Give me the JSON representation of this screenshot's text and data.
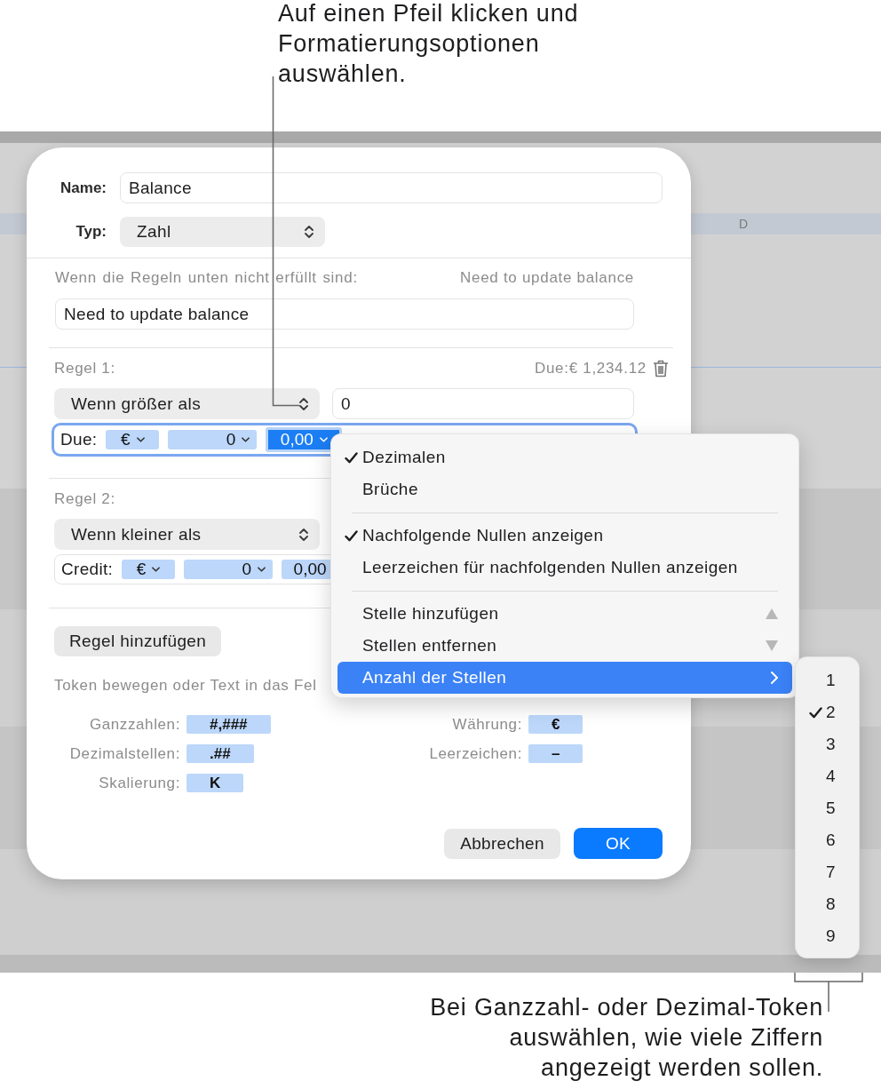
{
  "callout_top": {
    "lines": [
      "Auf einen Pfeil klicken und",
      "Formatierungsoptionen",
      "auswählen."
    ]
  },
  "spreadsheet": {
    "column_header": "D"
  },
  "dialog": {
    "name_label": "Name:",
    "name_value": "Balance",
    "type_label": "Typ:",
    "type_value": "Zahl",
    "fallback_label": "Wenn die Regeln unten nicht erfüllt sind:",
    "fallback_preview": "Need to update balance",
    "fallback_value": "Need to update balance",
    "rules": [
      {
        "label": "Regel 1:",
        "preview": "Due:€ 1,234.12",
        "trash": true,
        "condition": "Wenn größer als",
        "value": "0",
        "format": {
          "focused": true,
          "prefix": "Due:",
          "tokens": [
            {
              "kind": "currency",
              "text": "€",
              "selected": false
            },
            {
              "kind": "integer",
              "text": "0",
              "selected": false
            },
            {
              "kind": "decimal",
              "text": "0,00",
              "selected": true
            }
          ]
        }
      },
      {
        "label": "Regel 2:",
        "condition": "Wenn kleiner als",
        "format": {
          "focused": false,
          "prefix": "Credit:",
          "tokens": [
            {
              "kind": "currency",
              "text": "€",
              "selected": false
            },
            {
              "kind": "integer",
              "text": "0",
              "selected": false
            },
            {
              "kind": "decimal",
              "text": "0,00",
              "selected": false
            }
          ]
        }
      }
    ],
    "add_rule_button": "Regel hinzufügen",
    "token_hint": "Token bewegen oder Text in das Fel",
    "legend_left": [
      {
        "label": "Ganzzahlen:",
        "token": "#,###"
      },
      {
        "label": "Dezimalstellen:",
        "token": ".##"
      },
      {
        "label": "Skalierung:",
        "token": "K"
      }
    ],
    "legend_right": [
      {
        "label": "Währung:",
        "token": "€"
      },
      {
        "label": "Leerzeichen:",
        "token": "–"
      }
    ],
    "buttons": [
      {
        "kind": "secondary",
        "label": "Abbrechen"
      },
      {
        "kind": "primary",
        "label": "OK"
      }
    ]
  },
  "menu": {
    "groups": [
      {
        "items": [
          {
            "kind": "option",
            "label": "Dezimalen",
            "checked": true,
            "selected": false
          },
          {
            "kind": "option",
            "label": "Brüche",
            "checked": false,
            "selected": false
          }
        ]
      },
      {
        "items": [
          {
            "kind": "option",
            "label": "Nachfolgende Nullen anzeigen",
            "checked": true,
            "selected": false
          },
          {
            "kind": "option",
            "label": "Leerzeichen für nachfolgenden Nullen anzeigen",
            "checked": false,
            "selected": false
          }
        ]
      },
      {
        "items": [
          {
            "kind": "step_up",
            "label": "Stelle hinzufügen",
            "checked": false,
            "selected": false
          },
          {
            "kind": "step_down",
            "label": "Stellen entfernen",
            "checked": false,
            "selected": false
          },
          {
            "kind": "submenu",
            "label": "Anzahl der Stellen",
            "checked": false,
            "selected": true
          }
        ]
      }
    ]
  },
  "submenu": {
    "items": [
      {
        "label": "1",
        "checked": false
      },
      {
        "label": "2",
        "checked": true
      },
      {
        "label": "3",
        "checked": false
      },
      {
        "label": "4",
        "checked": false
      },
      {
        "label": "5",
        "checked": false
      },
      {
        "label": "6",
        "checked": false
      },
      {
        "label": "7",
        "checked": false
      },
      {
        "label": "8",
        "checked": false
      },
      {
        "label": "9",
        "checked": false
      }
    ]
  },
  "callout_bottom": {
    "lines": [
      "Bei Ganzzahl- oder Dezimal-Token",
      "auswählen, wie viele Ziffern",
      "angezeigt werden sollen."
    ]
  }
}
